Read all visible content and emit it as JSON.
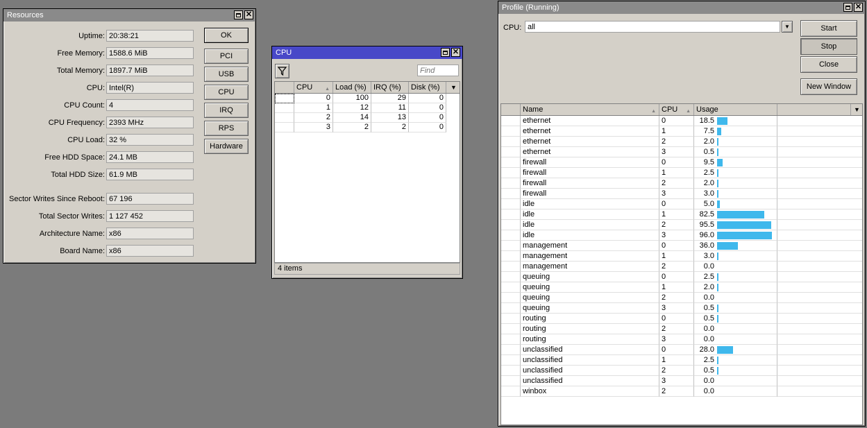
{
  "resources": {
    "title": "Resources",
    "fields": [
      {
        "label": "Uptime:",
        "value": "20:38:21"
      },
      {
        "label": "Free Memory:",
        "value": "1588.6 MiB"
      },
      {
        "label": "Total Memory:",
        "value": "1897.7 MiB"
      },
      {
        "label": "CPU:",
        "value": "Intel(R)"
      },
      {
        "label": "CPU Count:",
        "value": "4"
      },
      {
        "label": "CPU Frequency:",
        "value": "2393 MHz"
      },
      {
        "label": "CPU Load:",
        "value": "32 %"
      },
      {
        "label": "Free HDD Space:",
        "value": "24.1 MB"
      },
      {
        "label": "Total HDD Size:",
        "value": "61.9 MB"
      },
      {
        "label": "Sector Writes Since Reboot:",
        "value": "67 196"
      },
      {
        "label": "Total Sector Writes:",
        "value": "1 127 452"
      },
      {
        "label": "Architecture Name:",
        "value": "x86"
      },
      {
        "label": "Board Name:",
        "value": "x86"
      }
    ],
    "buttons": [
      "OK",
      "PCI",
      "USB",
      "CPU",
      "IRQ",
      "RPS",
      "Hardware"
    ]
  },
  "cpu": {
    "title": "CPU",
    "find_placeholder": "Find",
    "columns": [
      "CPU",
      "Load (%)",
      "IRQ (%)",
      "Disk (%)"
    ],
    "rows": [
      [
        "0",
        "100",
        "29",
        "0"
      ],
      [
        "1",
        "12",
        "11",
        "0"
      ],
      [
        "2",
        "14",
        "13",
        "0"
      ],
      [
        "3",
        "2",
        "2",
        "0"
      ]
    ],
    "status": "4 items"
  },
  "profile": {
    "title": "Profile (Running)",
    "cpu_label": "CPU:",
    "cpu_value": "all",
    "buttons": {
      "start": "Start",
      "stop": "Stop",
      "close": "Close",
      "new_window": "New Window"
    },
    "columns": [
      "Name",
      "CPU",
      "Usage"
    ],
    "rows": [
      {
        "name": "ethernet",
        "cpu": "0",
        "usage": "18.5"
      },
      {
        "name": "ethernet",
        "cpu": "1",
        "usage": "7.5"
      },
      {
        "name": "ethernet",
        "cpu": "2",
        "usage": "2.0"
      },
      {
        "name": "ethernet",
        "cpu": "3",
        "usage": "0.5"
      },
      {
        "name": "firewall",
        "cpu": "0",
        "usage": "9.5"
      },
      {
        "name": "firewall",
        "cpu": "1",
        "usage": "2.5"
      },
      {
        "name": "firewall",
        "cpu": "2",
        "usage": "2.0"
      },
      {
        "name": "firewall",
        "cpu": "3",
        "usage": "3.0"
      },
      {
        "name": "idle",
        "cpu": "0",
        "usage": "5.0"
      },
      {
        "name": "idle",
        "cpu": "1",
        "usage": "82.5"
      },
      {
        "name": "idle",
        "cpu": "2",
        "usage": "95.5"
      },
      {
        "name": "idle",
        "cpu": "3",
        "usage": "96.0"
      },
      {
        "name": "management",
        "cpu": "0",
        "usage": "36.0"
      },
      {
        "name": "management",
        "cpu": "1",
        "usage": "3.0"
      },
      {
        "name": "management",
        "cpu": "2",
        "usage": "0.0"
      },
      {
        "name": "queuing",
        "cpu": "0",
        "usage": "2.5"
      },
      {
        "name": "queuing",
        "cpu": "1",
        "usage": "2.0"
      },
      {
        "name": "queuing",
        "cpu": "2",
        "usage": "0.0"
      },
      {
        "name": "queuing",
        "cpu": "3",
        "usage": "0.5"
      },
      {
        "name": "routing",
        "cpu": "0",
        "usage": "0.5"
      },
      {
        "name": "routing",
        "cpu": "2",
        "usage": "0.0"
      },
      {
        "name": "routing",
        "cpu": "3",
        "usage": "0.0"
      },
      {
        "name": "unclassified",
        "cpu": "0",
        "usage": "28.0"
      },
      {
        "name": "unclassified",
        "cpu": "1",
        "usage": "2.5"
      },
      {
        "name": "unclassified",
        "cpu": "2",
        "usage": "0.5"
      },
      {
        "name": "unclassified",
        "cpu": "3",
        "usage": "0.0"
      },
      {
        "name": "winbox",
        "cpu": "2",
        "usage": "0.0"
      }
    ]
  },
  "colors": {
    "desktop": "#7b7b7b",
    "active_title": "#4848c8",
    "inactive_title": "#8a8a8a",
    "usage_bar": "#3fb8ec"
  }
}
